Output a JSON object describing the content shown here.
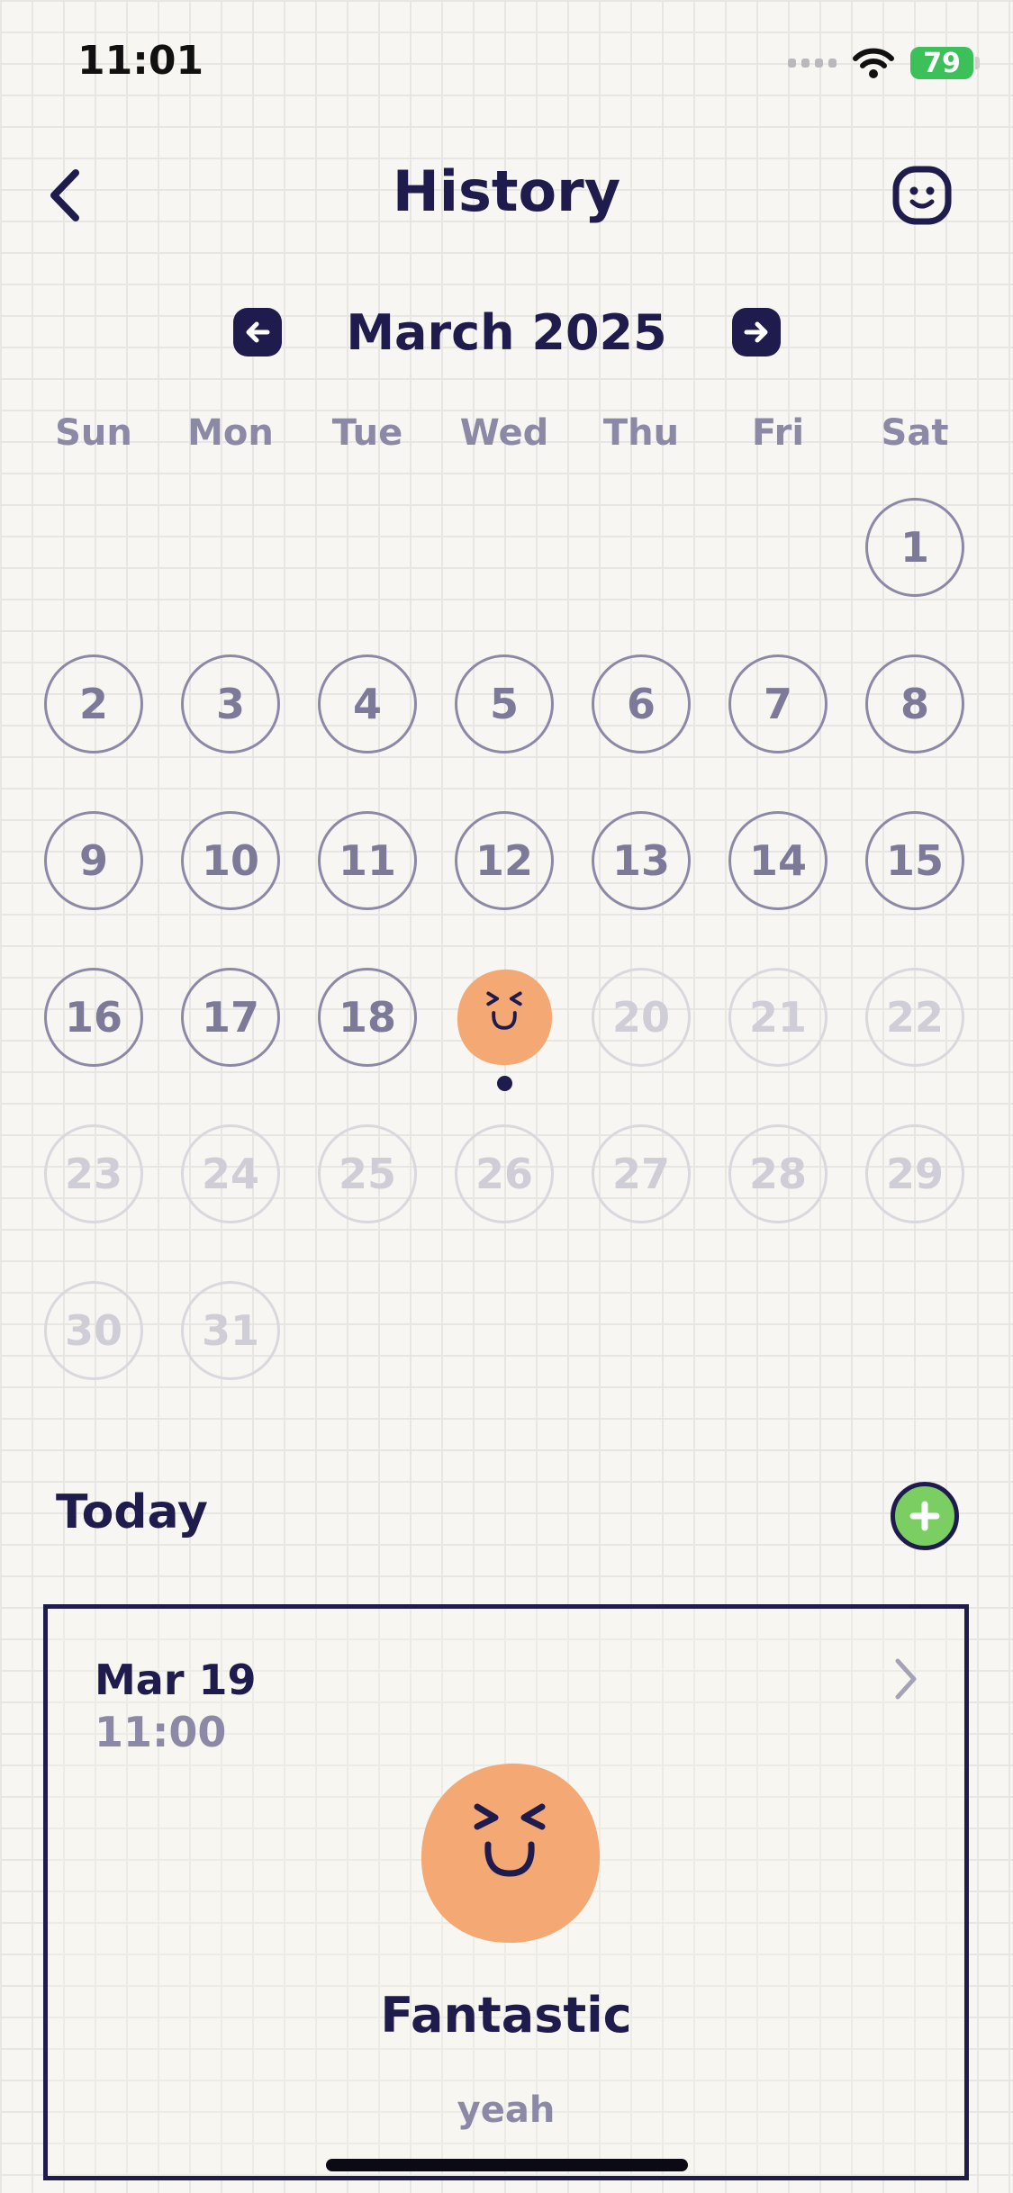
{
  "status_bar": {
    "time": "11:01",
    "battery": "79"
  },
  "header": {
    "title": "History"
  },
  "month_selector": {
    "label": "March 2025"
  },
  "weekdays": [
    "Sun",
    "Mon",
    "Tue",
    "Wed",
    "Thu",
    "Fri",
    "Sat"
  ],
  "calendar": {
    "leading_blank_days": 6,
    "days_in_month": 31,
    "past_days": [
      1,
      2,
      3,
      4,
      5,
      6,
      7,
      8,
      9,
      10,
      11,
      12,
      13,
      14,
      15,
      16,
      17,
      18
    ],
    "mood_day": 19,
    "future_days": [
      20,
      21,
      22,
      23,
      24,
      25,
      26,
      27,
      28,
      29,
      30,
      31
    ]
  },
  "today": {
    "title": "Today",
    "entry": {
      "date": "Mar 19",
      "time": "11:00",
      "mood": "Fantastic",
      "note": "yeah"
    }
  },
  "colors": {
    "navy": "#1f1b4d",
    "mood_orange": "#f4a873",
    "add_green": "#7bcf62",
    "battery_green": "#3cc15a",
    "muted_text": "#8c89a6"
  },
  "icons": {
    "back": "chevron-left-icon",
    "profile": "smiley-face-icon",
    "prev_month": "arrow-left-icon",
    "next_month": "arrow-right-icon",
    "add": "plus-icon",
    "entry_open": "chevron-right-icon"
  }
}
